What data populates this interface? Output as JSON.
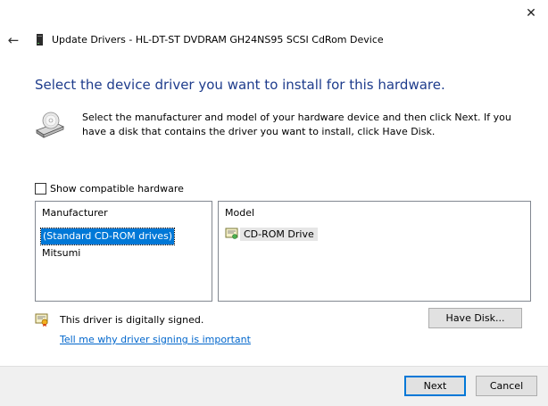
{
  "window": {
    "title": "Update Drivers - HL-DT-ST DVDRAM GH24NS95 SCSI CdRom Device",
    "close_glyph": "✕",
    "back_glyph": "←",
    "device_icon": "cd-drive-small-icon"
  },
  "heading": "Select the device driver you want to install for this hardware.",
  "instructions": "Select the manufacturer and model of your hardware device and then click Next. If you have a disk that contains the driver you want to install, click Have Disk.",
  "hardware_icon": "cd-drive-icon",
  "compatible_checkbox": {
    "label": "Show compatible hardware",
    "checked": false
  },
  "manufacturer_list": {
    "header": "Manufacturer",
    "items": [
      "(Standard CD-ROM drives)",
      "Mitsumi"
    ],
    "selected": "(Standard CD-ROM drives)"
  },
  "model_list": {
    "header": "Model",
    "items": [
      "CD-ROM Drive"
    ],
    "item_icon": "driver-certificate-icon"
  },
  "signing": {
    "status": "This driver is digitally signed.",
    "link": "Tell me why driver signing is important",
    "icon": "certificate-icon"
  },
  "buttons": {
    "have_disk": "Have Disk...",
    "next": "Next",
    "cancel": "Cancel"
  },
  "colors": {
    "heading": "#1e3c8c",
    "selection": "#0078d7",
    "link": "#0066cc",
    "footer": "#f0f0f0"
  }
}
